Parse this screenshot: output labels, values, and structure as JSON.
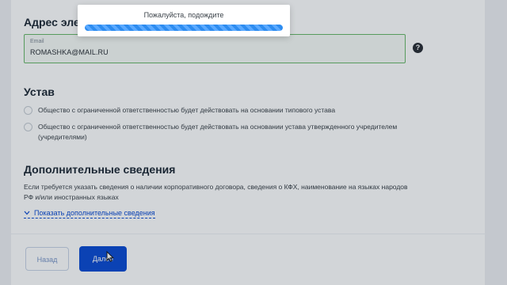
{
  "form": {
    "email_section_title": "Адрес эле",
    "email_field": {
      "label": "Email",
      "value": "ROMASHKA@MAIL.RU"
    },
    "help_icon": "?",
    "charter_title": "Устав",
    "charter_options": [
      {
        "text": "Общество с ограниченной ответственностью будет действовать на основании типового устава"
      },
      {
        "text": "Общество с ограниченной ответственностью будет действовать на основании устава утвержденного учредителем (учредителями)"
      }
    ],
    "additional_title": "Дополнительные сведения",
    "additional_desc": "Если требуется указать сведения о наличии корпоративного договора, сведения о КФХ, наименование на языках народов РФ и/или иностранных языках",
    "show_more_link": "Показать дополнительные сведения"
  },
  "actions": {
    "back_label": "Назад",
    "next_label": "Далее"
  },
  "loading_modal": {
    "message": "Пожалуйста, подождите"
  },
  "colors": {
    "accent": "#0d4cd3",
    "valid_border": "#6ab96a",
    "progress": "#2d8cf0"
  },
  "icons": [
    "question-mark-icon",
    "chevron-down-icon",
    "mouse-cursor-icon"
  ]
}
